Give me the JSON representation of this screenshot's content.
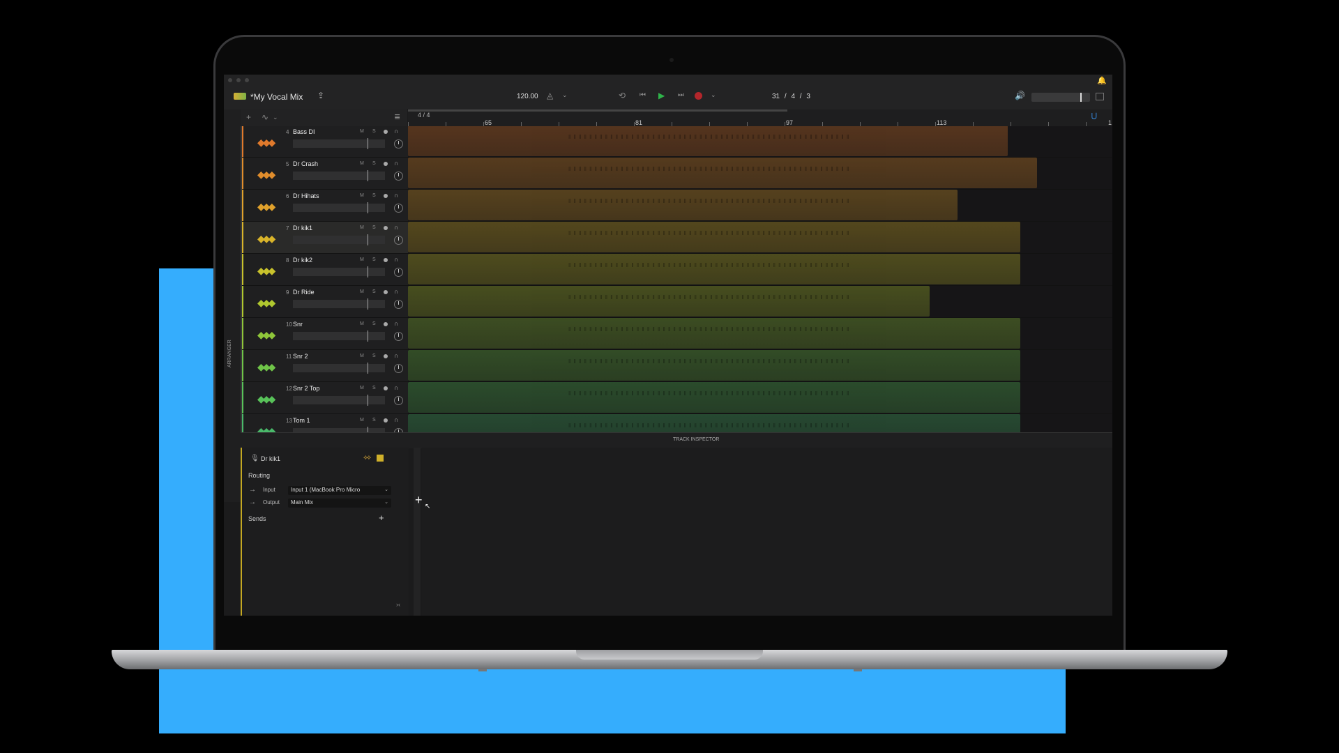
{
  "project": {
    "title": "*My Vocal Mix"
  },
  "transport": {
    "tempo": "120.00",
    "position": "31 / 4 / 3"
  },
  "ruler": {
    "time_signature": "4 / 4",
    "bars": [
      "65",
      "81",
      "97",
      "113",
      "1"
    ]
  },
  "sidebar": {
    "arranger_label": "ARRANGER"
  },
  "tracks": [
    {
      "num": "4",
      "name": "Bass DI",
      "color": "#e07a2c"
    },
    {
      "num": "5",
      "name": "Dr Crash",
      "color": "#e08d2c"
    },
    {
      "num": "6",
      "name": "Dr Hihats",
      "color": "#e0a12c"
    },
    {
      "num": "7",
      "name": "Dr kik1",
      "color": "#d9b42a",
      "selected": true
    },
    {
      "num": "8",
      "name": "Dr kik2",
      "color": "#c8c22c"
    },
    {
      "num": "9",
      "name": "Dr Ride",
      "color": "#b0c82f"
    },
    {
      "num": "10",
      "name": "Snr",
      "color": "#8fc63a"
    },
    {
      "num": "11",
      "name": "Snr 2",
      "color": "#6fc448"
    },
    {
      "num": "12",
      "name": "Snr 2 Top",
      "color": "#58c259"
    },
    {
      "num": "13",
      "name": "Tom 1",
      "color": "#4ab96a"
    }
  ],
  "track_buttons": {
    "mute": "M",
    "solo": "S"
  },
  "inspector": {
    "title": "TRACK INSPECTOR",
    "track_name": "Dr kik1",
    "routing_label": "Routing",
    "input_label": "Input",
    "input_value": "Input 1 (MacBook Pro Micro",
    "output_label": "Output",
    "output_value": "Main Mix",
    "sends_label": "Sends"
  }
}
